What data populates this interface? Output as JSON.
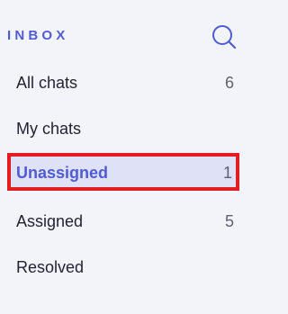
{
  "inbox": {
    "title": "INBOX",
    "search_icon": "search-icon",
    "accent_color": "#4f5bd1",
    "highlight_color": "#e31b23",
    "items": [
      {
        "label": "All chats",
        "count": "6",
        "selected": false
      },
      {
        "label": "My chats",
        "count": "",
        "selected": false
      },
      {
        "label": "Unassigned",
        "count": "1",
        "selected": true
      },
      {
        "label": "Assigned",
        "count": "5",
        "selected": false
      },
      {
        "label": "Resolved",
        "count": "",
        "selected": false
      }
    ]
  }
}
